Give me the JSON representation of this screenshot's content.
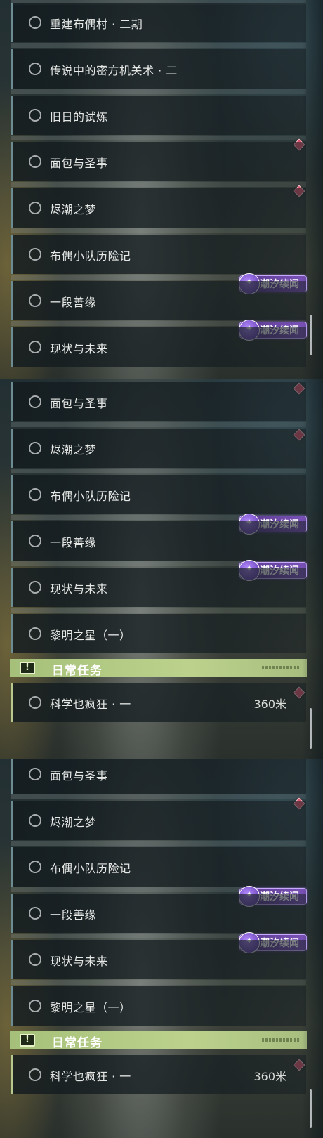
{
  "panel1": {
    "quests": [
      "重建布偶村 · 二期",
      "传说中的密方机关术 · 二",
      "旧日的试炼",
      "面包与圣事",
      "烬潮之梦",
      "布偶小队历险记",
      "一段善缘",
      "现状与未来"
    ]
  },
  "panel2": {
    "quests": [
      "面包与圣事",
      "烬潮之梦",
      "布偶小队历险记",
      "一段善缘",
      "现状与未来",
      "黎明之星（一）"
    ],
    "daily_header": "日常任务",
    "daily_quest": "科学也疯狂 · 一",
    "daily_distance": "360米"
  },
  "panel3": {
    "quests": [
      "面包与圣事",
      "烬潮之梦",
      "布偶小队历险记",
      "一段善缘",
      "现状与未来",
      "黎明之星（一）"
    ],
    "daily_header": "日常任务",
    "daily_quest": "科学也疯狂 · 一",
    "daily_distance": "360米"
  },
  "badge": {
    "tide_label": "潮汐续闻",
    "warn_glyph": "!"
  },
  "colors": {
    "accent_diamond": "#d9556e",
    "tide_badge": "#7a52b8",
    "daily_header": "#b6cc88",
    "quest_border": "#6c8c92"
  }
}
